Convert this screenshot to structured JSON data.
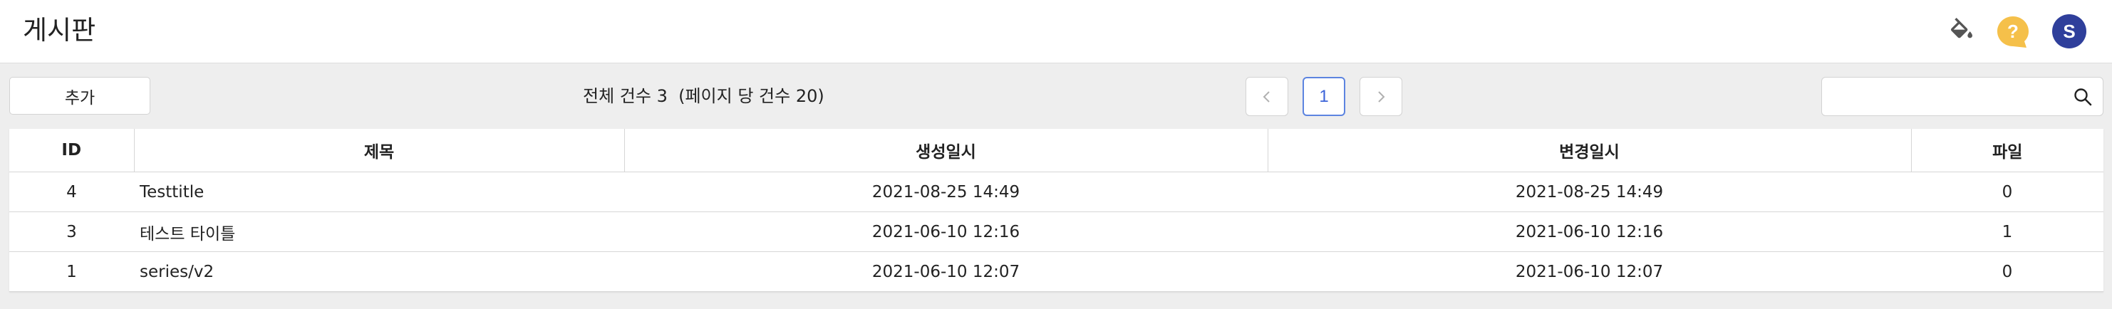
{
  "header": {
    "title": "게시판",
    "avatar_letter": "S",
    "icons": [
      "paint-bucket-icon",
      "help-icon"
    ],
    "colors": {
      "help": "#f5c04a",
      "avatar": "#2f3f9b"
    }
  },
  "toolbar": {
    "add_label": "추가",
    "count_text": "전체 건수 3  (페이지 당 건수 20)",
    "current_page": "1",
    "search": {
      "value": "",
      "placeholder": ""
    }
  },
  "table": {
    "columns": [
      "ID",
      "제목",
      "생성일시",
      "변경일시",
      "파일"
    ],
    "rows": [
      {
        "id": "4",
        "title": "Testtitle",
        "created": "2021-08-25 14:49",
        "updated": "2021-08-25 14:49",
        "files": "0"
      },
      {
        "id": "3",
        "title": "테스트 타이틀",
        "created": "2021-06-10 12:16",
        "updated": "2021-06-10 12:16",
        "files": "1"
      },
      {
        "id": "1",
        "title": "series/v2",
        "created": "2021-06-10 12:07",
        "updated": "2021-06-10 12:07",
        "files": "0"
      }
    ]
  },
  "colors": {
    "page_active": "#3b63d8",
    "background": "#eeeeee"
  }
}
